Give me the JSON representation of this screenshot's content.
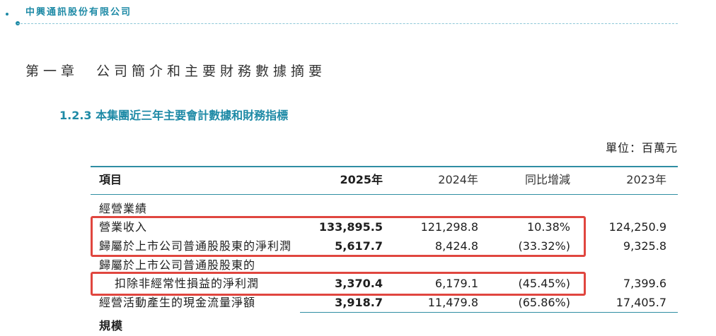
{
  "header": {
    "company_name": "中興通訊股份有限公司"
  },
  "chapter_title": "第一章　公司簡介和主要財務數據摘要",
  "section_title": "1.2.3 本集團近三年主要會計數據和財務指標",
  "unit": "單位：百萬元",
  "table": {
    "headers": {
      "item": "項目",
      "y2025": "2025年",
      "y2024": "2024年",
      "yoy": "同比增減",
      "y2023": "2023年"
    },
    "group1": "經營業績",
    "rows": [
      {
        "label": "營業收入",
        "y2025": "133,895.5",
        "y2024": "121,298.8",
        "yoy": "10.38%",
        "y2023": "124,250.9"
      },
      {
        "label": "歸屬於上市公司普通股股東的淨利潤",
        "y2025": "5,617.7",
        "y2024": "8,424.8",
        "yoy": "(33.32%)",
        "y2023": "9,325.8"
      },
      {
        "label": "歸屬於上市公司普通股股東的",
        "label2": "扣除非經常性損益的淨利潤",
        "y2025": "3,370.4",
        "y2024": "6,179.1",
        "yoy": "(45.45%)",
        "y2023": "7,399.6"
      },
      {
        "label": "經營活動產生的現金流量淨額",
        "y2025": "3,918.7",
        "y2024": "11,479.8",
        "yoy": "(65.86%)",
        "y2023": "17,405.7"
      }
    ],
    "group2": "規模"
  },
  "colors": {
    "accent": "#1e8aa6",
    "rule": "#2f8ea3",
    "highlight": "#e0463f"
  }
}
